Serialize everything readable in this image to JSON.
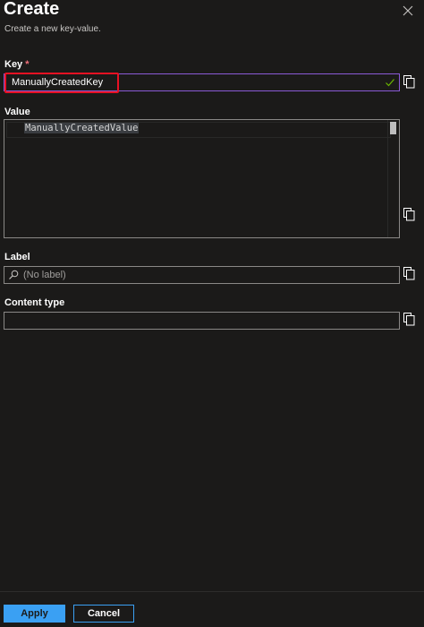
{
  "header": {
    "title": "Create",
    "subtitle": "Create a new key-value."
  },
  "key": {
    "label": "Key",
    "required_marker": "*",
    "value": "ManuallyCreatedKey"
  },
  "value": {
    "label": "Value",
    "text": "ManuallyCreatedValue"
  },
  "label_field": {
    "label": "Label",
    "placeholder": "(No label)"
  },
  "content_type": {
    "label": "Content type",
    "value": ""
  },
  "footer": {
    "apply_label": "Apply",
    "cancel_label": "Cancel"
  },
  "icons": {
    "close": "close-icon",
    "copy": "copy-icon",
    "check": "checkmark-icon",
    "search": "search-icon"
  },
  "colors": {
    "background": "#1b1a19",
    "accent": "#3aa0f3",
    "required": "#f1707b",
    "focus_border": "#8a5ad6",
    "highlight": "#e81123",
    "valid_check": "#6bb700"
  }
}
